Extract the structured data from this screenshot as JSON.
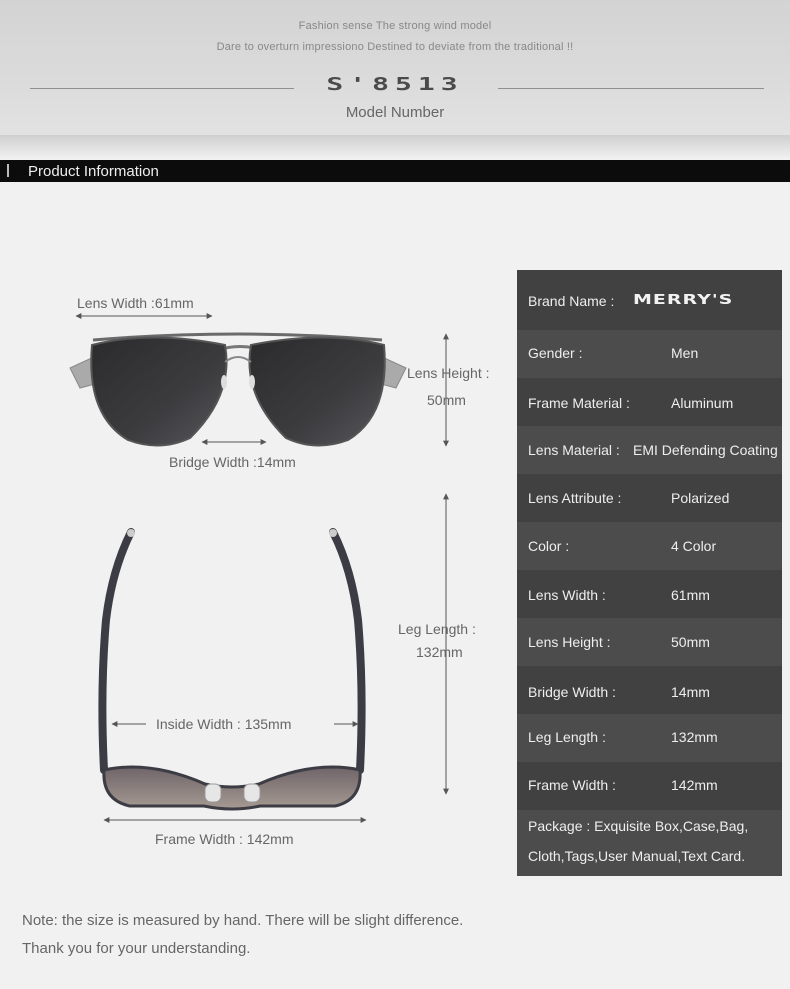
{
  "header": {
    "tagline_1": "Fashion sense The strong wind model",
    "tagline_2": "Dare to overturn impressiono Destined to deviate from the traditional !!",
    "model_number": "S'8513",
    "model_label": "Model Number"
  },
  "section": {
    "title": "Product Information"
  },
  "dimensions": {
    "lens_width": "Lens Width :61mm",
    "lens_height_label": "Lens Height :",
    "lens_height_value": "50mm",
    "bridge_width": "Bridge Width :14mm",
    "leg_length_label": "Leg Length :",
    "leg_length_value": "132mm",
    "inside_width": "Inside  Width : 135mm",
    "frame_width": "Frame Width : 142mm"
  },
  "specs": {
    "brand_label": "Brand Name :",
    "brand_logo": "MERRY'S",
    "rows": [
      {
        "label": "Gender :",
        "value": "Men"
      },
      {
        "label": "Frame Material :",
        "value": "Aluminum"
      },
      {
        "label": "Lens Material :",
        "value": "EMI Defending Coating"
      },
      {
        "label": "Lens Attribute :",
        "value": "Polarized"
      },
      {
        "label": "Color :",
        "value": "4 Color"
      },
      {
        "label": "Lens Width :",
        "value": "61mm"
      },
      {
        "label": "Lens Height :",
        "value": "50mm"
      },
      {
        "label": "Bridge Width :",
        "value": "14mm"
      },
      {
        "label": "Leg Length :",
        "value": "132mm"
      },
      {
        "label": "Frame Width :",
        "value": "142mm"
      }
    ],
    "package_line_1": "Package : Exquisite Box,Case,Bag,",
    "package_line_2": "Cloth,Tags,User Manual,Text Card."
  },
  "note": {
    "line_1": "Note: the size is measured by hand. There will be slight difference.",
    "line_2": "Thank you for your understanding."
  },
  "colors": {
    "spec_row_dark": "#414141",
    "spec_row_light": "#4c4c4c",
    "section_bar": "#0c0c0c",
    "page_background": "#f2f1f1"
  }
}
